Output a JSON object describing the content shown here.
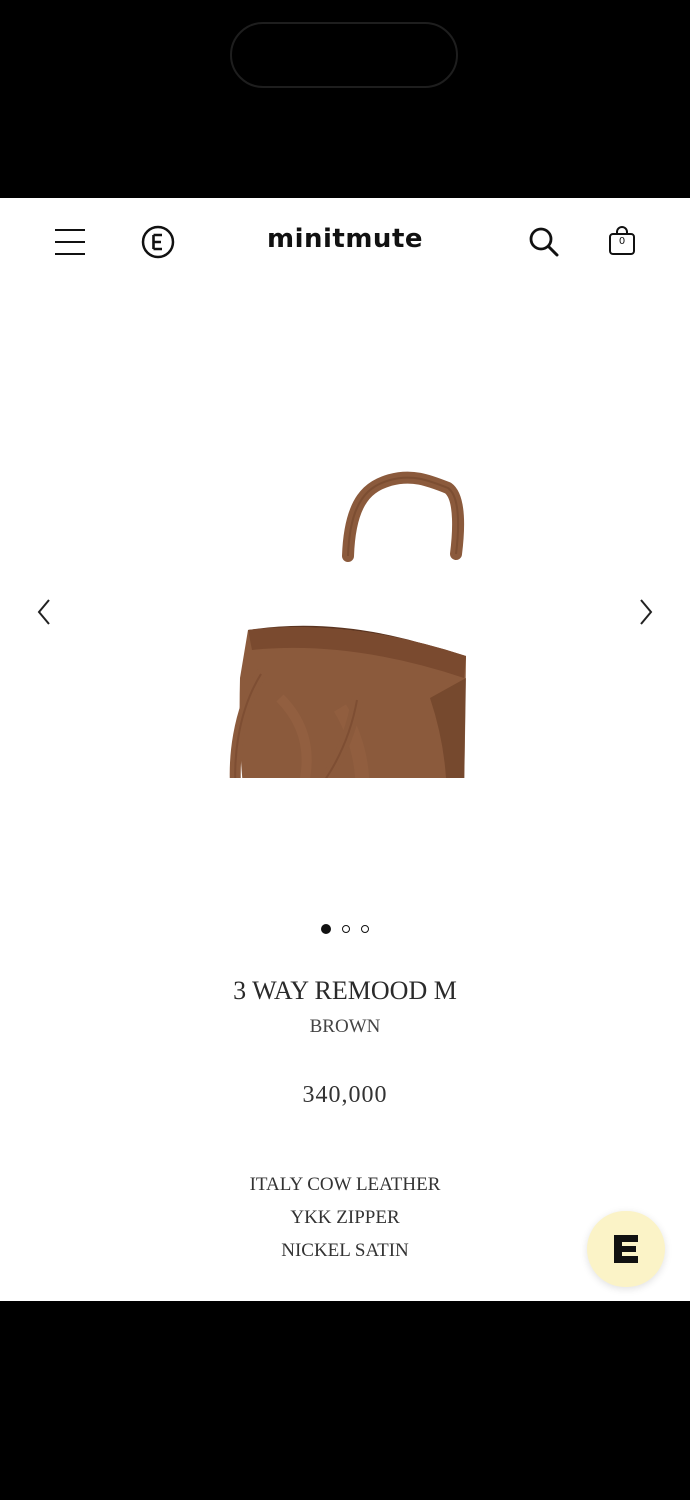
{
  "header": {
    "logo": "minitmute",
    "cart_count": "0",
    "icons": [
      "menu-icon",
      "e-brand-icon",
      "search-icon",
      "shopping-bag-icon"
    ]
  },
  "carousel": {
    "image": "brown-leather-tote-bag",
    "slide_count": 3,
    "active_slide": 1,
    "prev_icon": "chevron-left-icon",
    "next_icon": "chevron-right-icon"
  },
  "product": {
    "name": "3 WAY REMOOD M",
    "color": "BROWN",
    "price": "340,000",
    "features": [
      "ITALY COW LEATHER",
      "YKK ZIPPER",
      "NICKEL SATIN"
    ]
  },
  "chat": {
    "icon": "e-chat-icon",
    "background": "#fbf3c7"
  },
  "colors": {
    "bag": "#8b5a3c",
    "text": "#333333",
    "background": "#ffffff"
  }
}
